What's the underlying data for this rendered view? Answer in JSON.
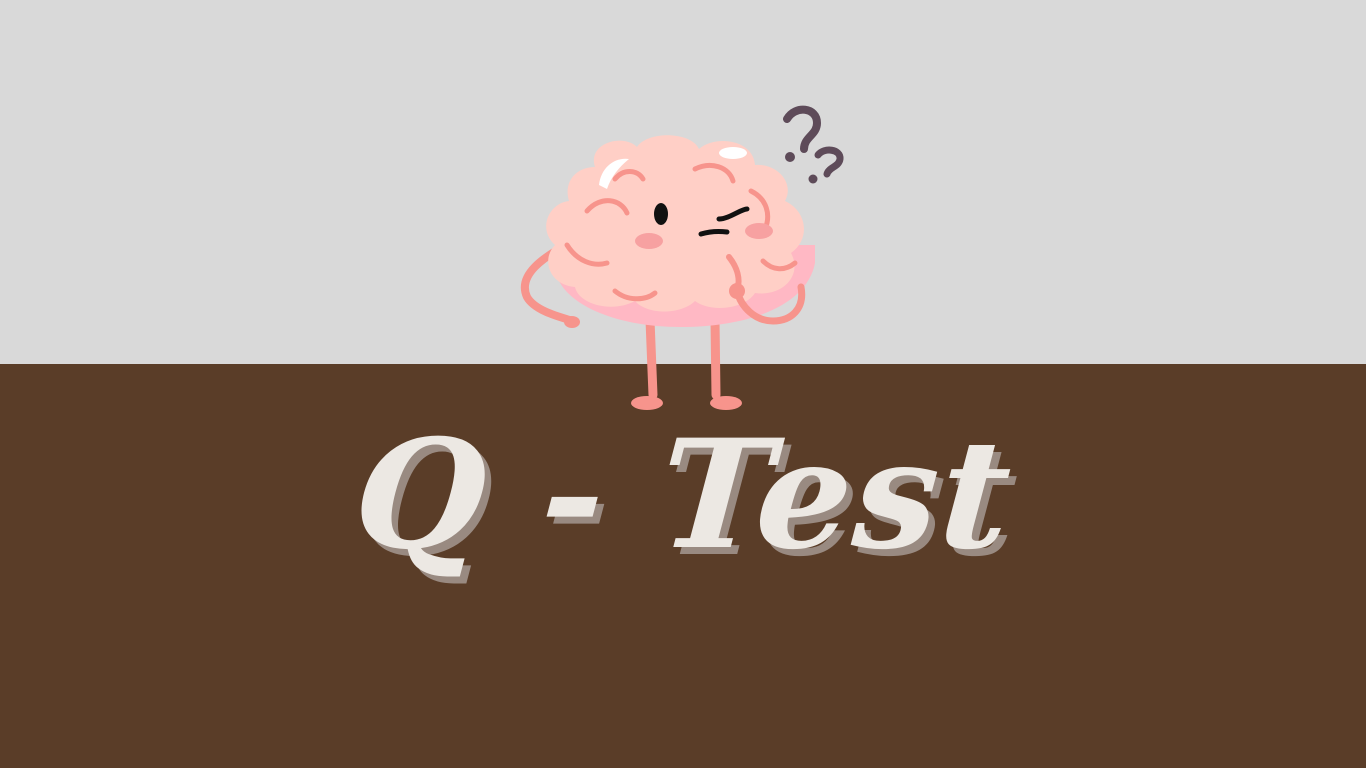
{
  "colors": {
    "sky": "#d9d9d9",
    "ground": "#5a3d28",
    "brain_fill": "#ffcfc6",
    "brain_lower": "#ffb8c4",
    "brain_line": "#f7948c",
    "highlight": "#ffffff",
    "face": "#111111",
    "cheek": "#f7a1a1",
    "question_marks": "#5e4b59",
    "title_text": "#ece8e3",
    "title_shadow": "#a59891"
  },
  "illustration": {
    "character": "thinking-brain",
    "question_marks": "??"
  },
  "title": {
    "text": "Q - Test"
  }
}
